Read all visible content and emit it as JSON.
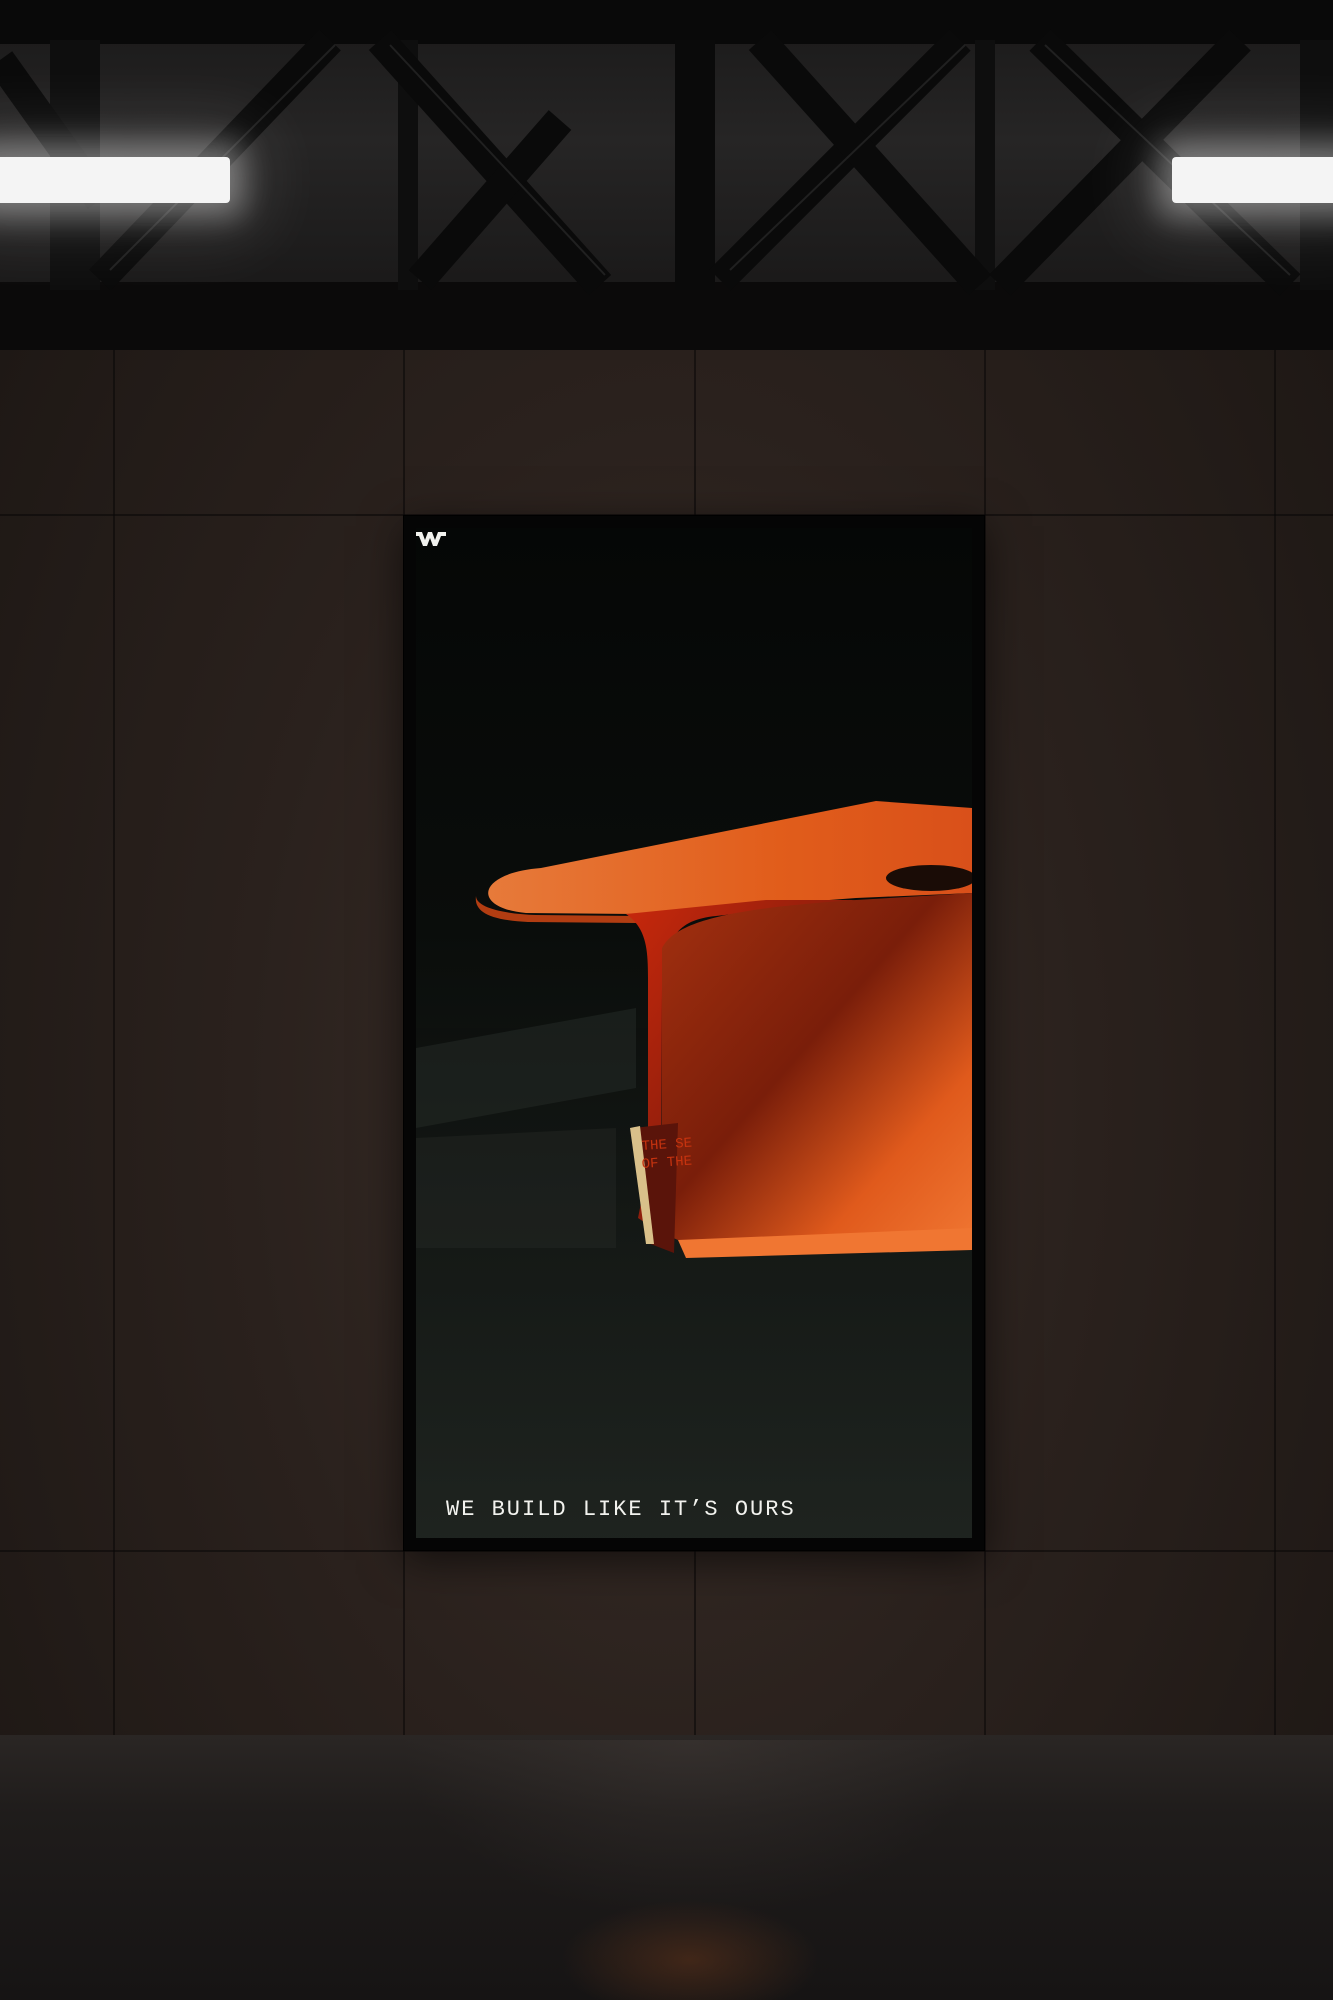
{
  "poster": {
    "tagline": "WE BUILD LIKE IT’S OURS",
    "logo_icon": "w-brand-logo"
  },
  "colors": {
    "accent_orange": "#e8611c",
    "wall": "#2e2420",
    "screen_bg": "#0a0d0b"
  }
}
